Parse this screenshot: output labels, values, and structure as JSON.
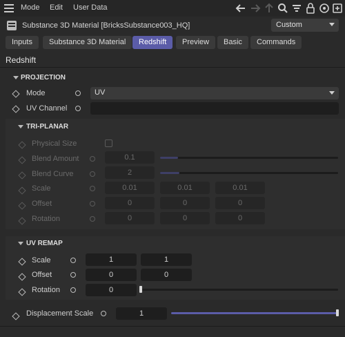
{
  "menu": {
    "mode": "Mode",
    "edit": "Edit",
    "user_data": "User Data"
  },
  "title": "Substance 3D Material [BricksSubstance003_HQ]",
  "preset": "Custom",
  "tabs": [
    "Inputs",
    "Substance 3D Material",
    "Redshift",
    "Preview",
    "Basic",
    "Commands"
  ],
  "section_title": "Redshift",
  "projection": {
    "header": "PROJECTION",
    "mode_label": "Mode",
    "mode_value": "UV",
    "uv_channel_label": "UV Channel",
    "uv_channel_value": ""
  },
  "triplanar": {
    "header": "TRI-PLANAR",
    "physical_size_label": "Physical Size",
    "blend_amount_label": "Blend Amount",
    "blend_amount_value": "0.1",
    "blend_amount_fraction": 0.1,
    "blend_curve_label": "Blend Curve",
    "blend_curve_value": "2",
    "blend_curve_fraction": 0.11,
    "scale_label": "Scale",
    "scale_values": [
      "0.01",
      "0.01",
      "0.01"
    ],
    "offset_label": "Offset",
    "offset_values": [
      "0",
      "0",
      "0"
    ],
    "rotation_label": "Rotation",
    "rotation_values": [
      "0",
      "0",
      "0"
    ]
  },
  "uv_remap": {
    "header": "UV REMAP",
    "scale_label": "Scale",
    "scale_values": [
      "1",
      "1"
    ],
    "offset_label": "Offset",
    "offset_values": [
      "0",
      "0"
    ],
    "rotation_label": "Rotation",
    "rotation_value": "0"
  },
  "displacement": {
    "label": "Displacement Scale",
    "value": "1",
    "fraction": 1.0
  },
  "colors": {
    "accent": "#5b5ca8",
    "background": "#2a2a2a"
  }
}
